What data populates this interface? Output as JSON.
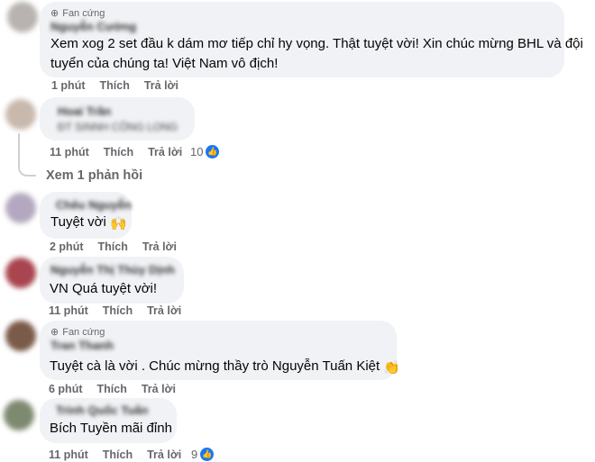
{
  "comments": [
    {
      "badge": "Fan cứng",
      "name": "Nguyễn Cường",
      "text_line1": "Xem xog 2 set đầu k dám mơ tiếp chỉ hy vọng. Thật tuyệt vời! Xin chúc mừng BHL và đội",
      "text_line2": "tuyển của chúng ta! Việt Nam vô địch!",
      "time": "1 phút",
      "like_label": "Thích",
      "reply_label": "Trả lời"
    },
    {
      "name": "Hoai Trần",
      "subname": "ĐT SINNH CÔNG LONG",
      "time": "11 phút",
      "like_label": "Thích",
      "reply_label": "Trả lời",
      "reaction_count": "10",
      "view_replies": "Xem 1 phản hồi"
    },
    {
      "name": "Chêu Nguyễn",
      "text": "Tuyệt vời",
      "time": "2 phút",
      "like_label": "Thích",
      "reply_label": "Trả lời"
    },
    {
      "name": "Nguyễn Thị Thùy Dịnh",
      "text": "VN Quá tuyệt vời!",
      "time": "11 phút",
      "like_label": "Thích",
      "reply_label": "Trả lời"
    },
    {
      "badge": "Fan cứng",
      "name": "Tran Thanh",
      "text": "Tuyệt cà là vời . Chúc mừng thầy trò Nguyễn Tuấn Kiệt",
      "time": "6 phút",
      "like_label": "Thích",
      "reply_label": "Trả lời"
    },
    {
      "name": "Trinh Quốc Tuấn",
      "text": "Bích Tuyền mãi đỉnh",
      "time": "11 phút",
      "like_label": "Thích",
      "reply_label": "Trả lời",
      "reaction_count": "9"
    }
  ],
  "colors": {
    "bubble": "#f0f2f5",
    "meta": "#65676b",
    "like": "#1877f2"
  }
}
